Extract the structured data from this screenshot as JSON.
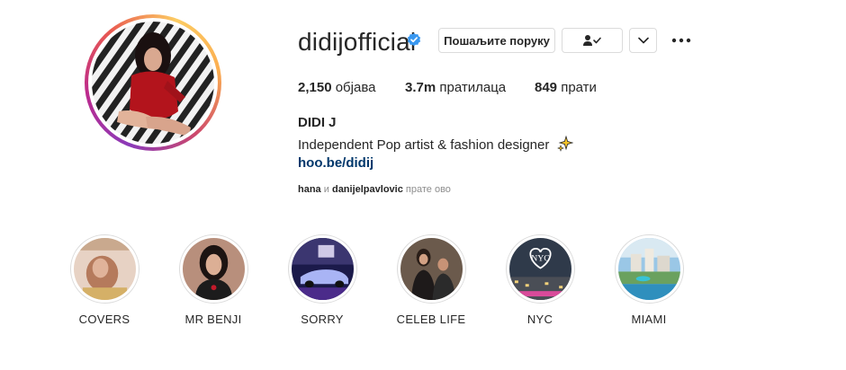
{
  "profile": {
    "username": "didijofficial",
    "verified": true,
    "full_name": "DIDI J",
    "bio": "Independent Pop artist & fashion designer",
    "link": "hoo.be/didij",
    "avatar_icon": "profile-photo"
  },
  "actions": {
    "message_label": "Пошаљите поруку",
    "following_icon": "person-check-icon",
    "dropdown_icon": "chevron-down-icon",
    "more_icon": "more-dots-icon"
  },
  "stats": {
    "posts_count": "2,150",
    "posts_label": "објава",
    "followers_count": "3.7m",
    "followers_label": "пратилаца",
    "following_count": "849",
    "following_label": "прати"
  },
  "followed_by": {
    "user1": "hana",
    "conj": "и",
    "user2": "danijelpavlovic",
    "suffix": "прате ово"
  },
  "highlights": [
    {
      "label": "COVERS"
    },
    {
      "label": "MR BENJI"
    },
    {
      "label": "SORRY"
    },
    {
      "label": "CELEB LIFE"
    },
    {
      "label": "NYC",
      "overlay_text": "NYC"
    },
    {
      "label": "MIAMI"
    }
  ],
  "colors": {
    "text": "#262626",
    "muted": "#8e8e8e",
    "link": "#00376b",
    "verified": "#3897f0",
    "border": "#dbdbdb"
  }
}
